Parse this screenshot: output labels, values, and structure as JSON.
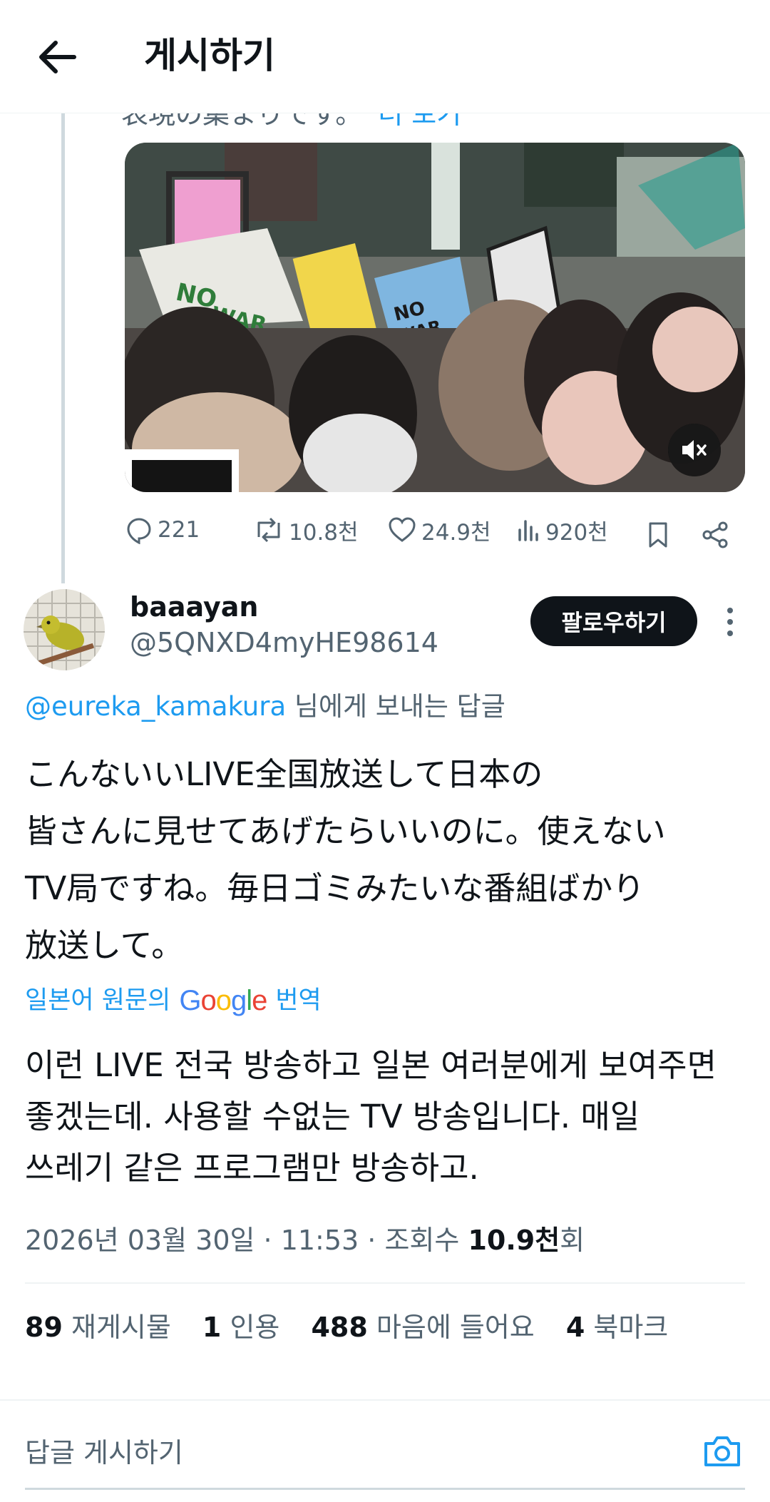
{
  "header": {
    "title": "게시하기",
    "back_icon": "arrow-left-icon"
  },
  "quoted": {
    "cut_text": "表現の集まりです。",
    "more_label": "더 보기",
    "metrics": {
      "replies": "221",
      "reposts": "10.8천",
      "likes": "24.9천",
      "views": "920천"
    }
  },
  "author": {
    "name": "baaayan",
    "handle": "@5QNXD4myHE98614",
    "follow_label": "팔로우하기"
  },
  "reply_to": {
    "mention": "@eureka_kamakura",
    "suffix": " 님에게 보내는 답글"
  },
  "original_text": [
    "こんないいLIVE全国放送して日本の",
    "皆さんに見せてあげたらいいのに。使えない",
    "TV局ですね。毎日ゴミみたいな番組ばかり",
    "放送して。"
  ],
  "translation": {
    "prefix": "일본어 원문의",
    "provider": "Google",
    "suffix": "번역"
  },
  "translated_text": [
    "이런 LIVE 전국 방송하고 일본 여러분에게 보여주면",
    "좋겠는데. 사용할 수없는 TV 방송입니다. 매일",
    "쓰레기 같은 프로그램만 방송하고."
  ],
  "meta": {
    "date": "2026년 03월 30일",
    "time": "11:53",
    "views_label": "조회수",
    "views_value": "10.9천",
    "views_unit": "회"
  },
  "stats": [
    {
      "num": "89",
      "label": "재게시물"
    },
    {
      "num": "1",
      "label": "인용"
    },
    {
      "num": "488",
      "label": "마음에 들어요"
    },
    {
      "num": "4",
      "label": "북마크"
    }
  ],
  "reply_input": {
    "placeholder": "답글 게시하기"
  },
  "colors": {
    "accent": "#1d9bf0",
    "text": "#0f1419",
    "secondary": "#536471"
  }
}
